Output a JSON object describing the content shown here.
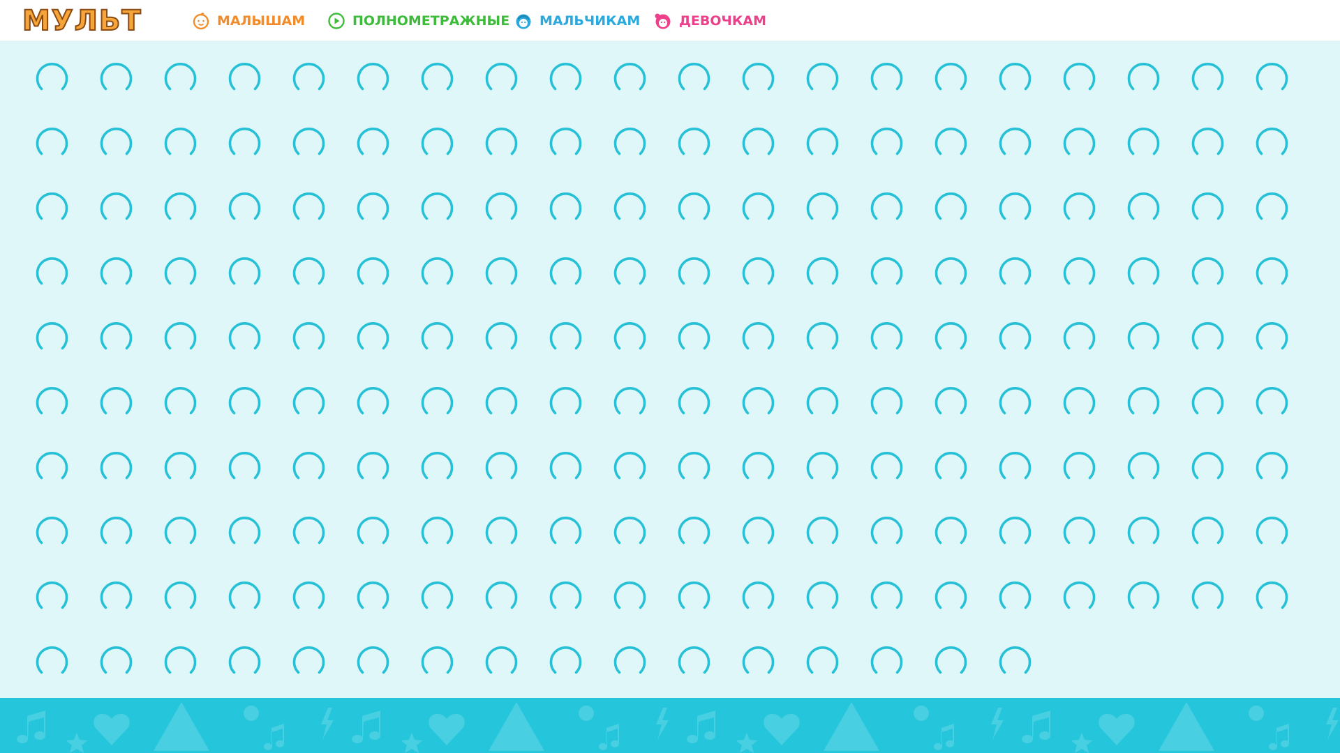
{
  "header": {
    "logo_text": "МУЛЬТ",
    "nav": [
      {
        "label": "МАЛЫШАМ",
        "color": "#f28c2a",
        "icon": "baby-face-icon"
      },
      {
        "label": "ПОЛНОМЕТРАЖНЫЕ",
        "color": "#3dbb3a",
        "icon": "play-circle-icon"
      },
      {
        "label": "МАЛЬЧИКАМ",
        "color": "#2aa9de",
        "icon": "boy-face-icon"
      },
      {
        "label": "ДЕВОЧКАМ",
        "color": "#ee3f8a",
        "icon": "girl-face-icon"
      }
    ]
  },
  "main": {
    "loading_tile_count": 196,
    "spinner_icon": "loading-spinner-icon",
    "spinner_color": "#26c1d6",
    "background_color": "#e0f7f9"
  },
  "footer": {
    "background_color": "#25c6dc",
    "pattern_icons": [
      "heart-icon",
      "music-note-icon",
      "star-icon",
      "lightning-icon",
      "gear-icon",
      "triangle-icon"
    ]
  }
}
